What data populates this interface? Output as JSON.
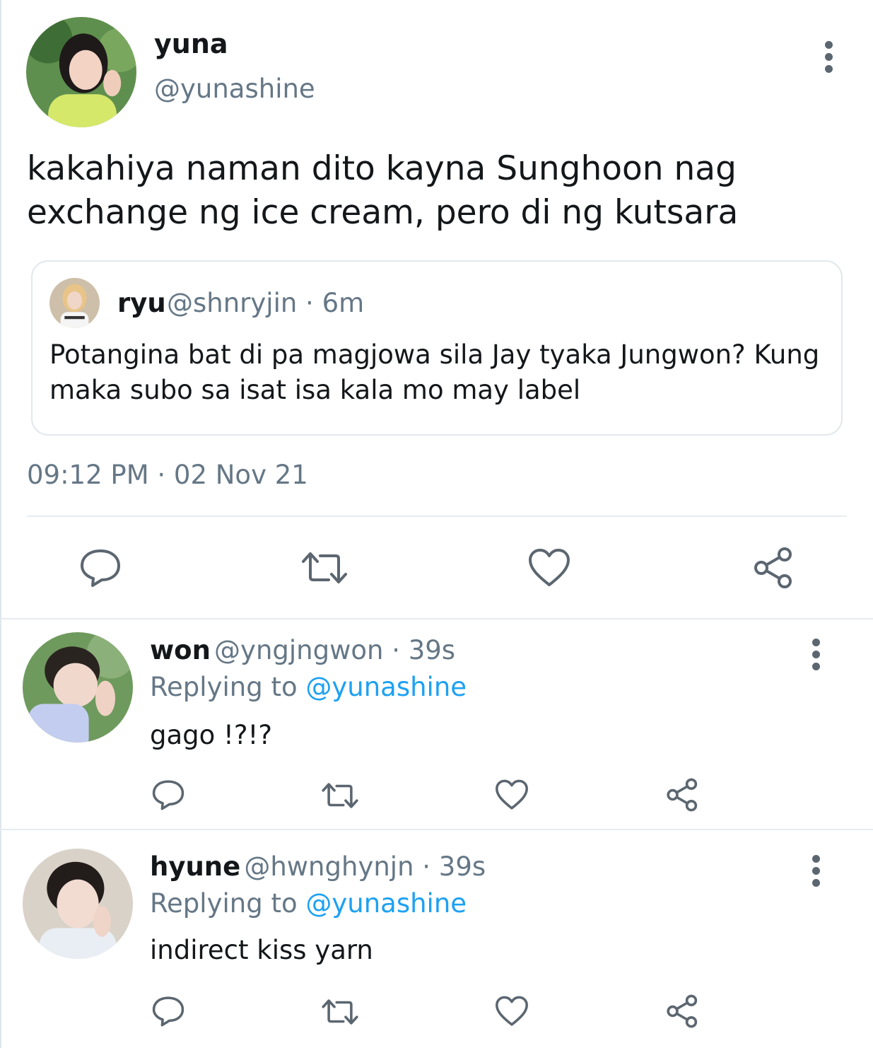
{
  "main_tweet": {
    "name": "yuna",
    "handle": "@yunashine",
    "text": "kakahiya naman dito kayna Sunghoon nag exchange ng ice cream, pero di ng kutsara",
    "timestamp": "09:12 PM · 02 Nov 21",
    "quoted": {
      "name": "ryu",
      "meta": "@shnryjin · 6m",
      "text": "Potangina bat di pa magjowa sila Jay tyaka Jungwon? Kung maka subo sa isat isa kala mo may label"
    }
  },
  "replies": [
    {
      "name": "won",
      "meta": "@yngjngwon · 39s",
      "replying_prefix": "Replying to ",
      "replying_to": "@yunashine",
      "text": "gago !?!?"
    },
    {
      "name": "hyune",
      "meta": "@hwnghynjn · 39s",
      "replying_prefix": "Replying to ",
      "replying_to": "@yunashine",
      "text": "indirect kiss yarn"
    }
  ],
  "icons": [
    "more-vertical-icon",
    "reply-icon",
    "retweet-icon",
    "like-icon",
    "share-icon"
  ],
  "colors": {
    "text": "#14171a",
    "secondary": "#657786",
    "link": "#1da1f2",
    "icon": "#5b6670",
    "border": "#e1e8ed"
  }
}
